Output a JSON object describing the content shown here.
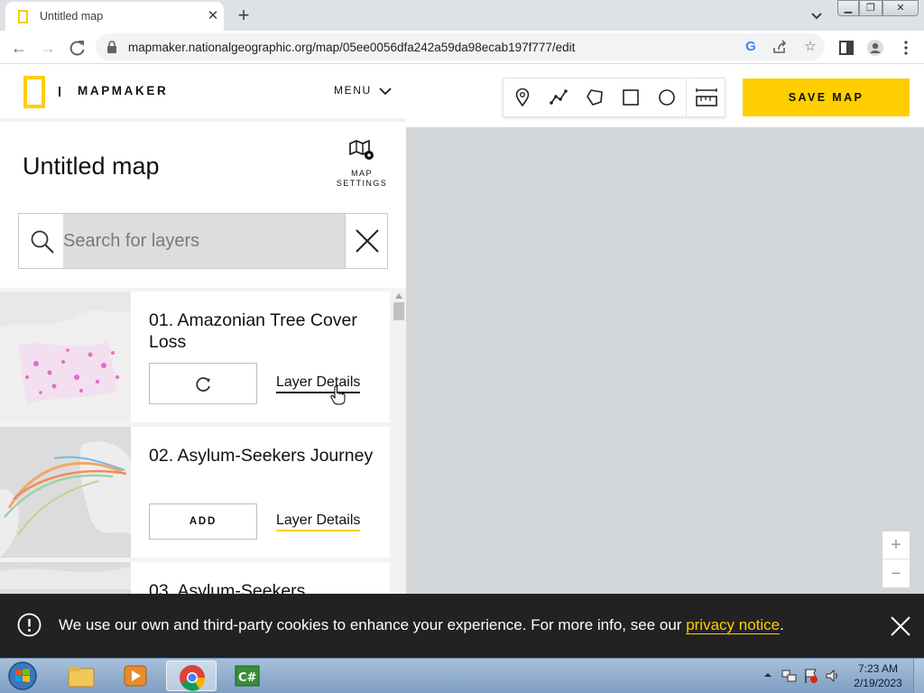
{
  "browser": {
    "tab_title": "Untitled map",
    "tab_close": "✕",
    "new_tab": "+",
    "url": "mapmaker.nationalgeographic.org/map/05ee0056dfa242a59da98ecab197f777/edit"
  },
  "app": {
    "brand_name": "MAPMAKER",
    "brand_sep": "|",
    "menu_label": "MENU",
    "map_title": "Untitled map",
    "map_settings_label": "MAP SETTINGS",
    "search_placeholder": "Search for layers",
    "save_label": "SAVE MAP",
    "zoom_in": "+",
    "zoom_out": "−",
    "layers": [
      {
        "title": "01. Amazonian Tree Cover Loss",
        "action": "",
        "details": "Layer Details"
      },
      {
        "title": "02. Asylum-Seekers Journey",
        "action": "ADD",
        "details": "Layer Details"
      },
      {
        "title": "03. Asylum-Seekers"
      }
    ]
  },
  "cookie": {
    "text": "We use our own and third-party cookies to enhance your experience. For more info, see our",
    "link": "privacy notice",
    "suffix": "."
  },
  "taskbar": {
    "time": "7:23 AM",
    "date": "2/19/2023"
  },
  "colors": {
    "brand_yellow": "#ffce00",
    "cookie_bg": "#222222",
    "map_bg": "#d3d6d8"
  }
}
